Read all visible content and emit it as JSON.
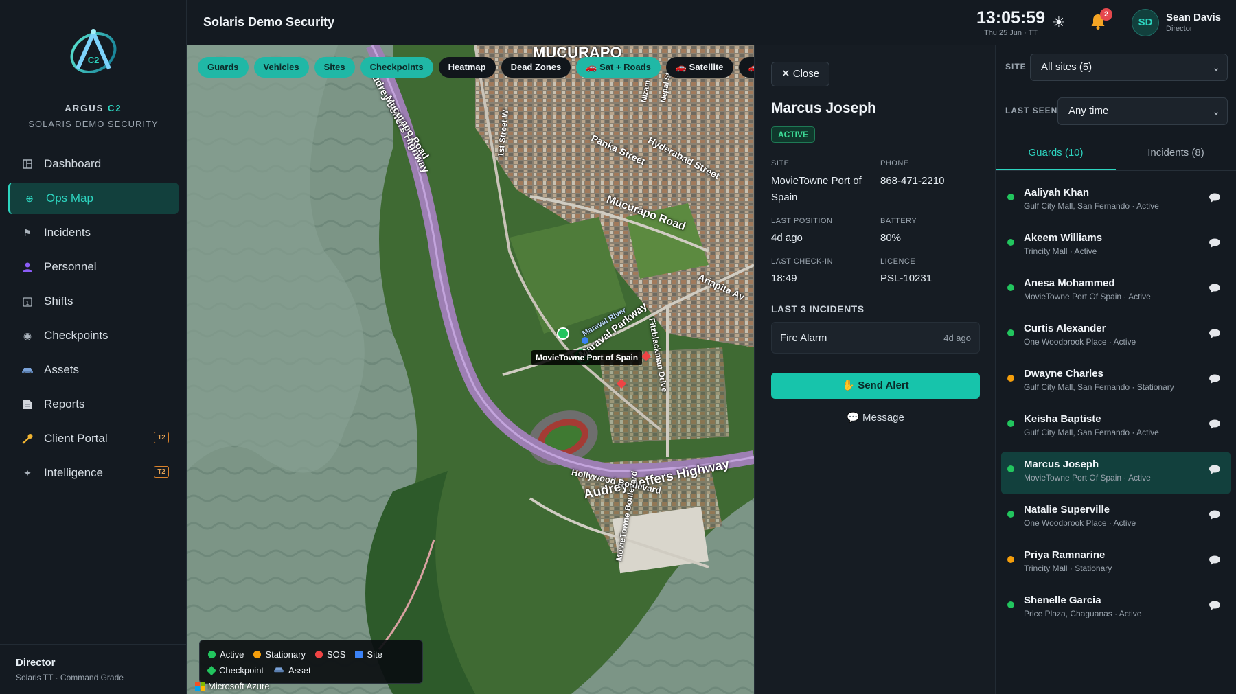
{
  "brand": {
    "name_main": "ARGUS",
    "name_accent": "C2",
    "subtitle": "SOLARIS DEMO SECURITY"
  },
  "sidebar": {
    "items": [
      {
        "label": "Dashboard",
        "icon": "dashboard-icon"
      },
      {
        "label": "Ops Map",
        "icon": "globe-icon",
        "active": true
      },
      {
        "label": "Incidents",
        "icon": "flag-icon"
      },
      {
        "label": "Personnel",
        "icon": "person-icon"
      },
      {
        "label": "Shifts",
        "icon": "calendar-icon"
      },
      {
        "label": "Checkpoints",
        "icon": "target-icon"
      },
      {
        "label": "Assets",
        "icon": "car-icon"
      },
      {
        "label": "Reports",
        "icon": "document-icon"
      },
      {
        "label": "Client Portal",
        "icon": "key-icon",
        "tier": "T2"
      },
      {
        "label": "Intelligence",
        "icon": "sparkle-icon",
        "tier": "T2"
      }
    ],
    "footer": {
      "role": "Director",
      "org": "Solaris TT · Command Grade"
    }
  },
  "topbar": {
    "title": "Solaris Demo Security",
    "time": "13:05:59",
    "date": "Thu 25 Jun · TT",
    "notification_count": "2",
    "user": {
      "initials": "SD",
      "name": "Sean Davis",
      "role": "Director"
    }
  },
  "map": {
    "chips": [
      {
        "label": "Guards",
        "on": true
      },
      {
        "label": "Vehicles",
        "on": true
      },
      {
        "label": "Sites",
        "on": true
      },
      {
        "label": "Checkpoints",
        "on": true
      },
      {
        "label": "Heatmap",
        "on": false
      },
      {
        "label": "Dead Zones",
        "on": false
      },
      {
        "label": "🚗 Sat + Roads",
        "on": true
      },
      {
        "label": "🚗 Satellite",
        "on": false
      },
      {
        "label": "🚗 Ro",
        "on": false
      }
    ],
    "labels": {
      "district": "MUCURAPO",
      "road_1": "Audrey Jeffers Highway",
      "road_2": "Audrey Jeffers Highway",
      "road_3": "Mucurapo Road",
      "road_4": "Mucurapo Road",
      "road_5": "Panka Street",
      "road_6": "Hyderabad Street",
      "road_7": "Maraval Parkway",
      "road_8": "Ariapita Av",
      "road_9": "Fitzblackman Drive",
      "road_10": "Hollywood Boulevard",
      "road_11": "MovieTowne Boulevard",
      "road_12": "1st Street W",
      "road_13": "Maraval River",
      "road_14": "Nizam St",
      "road_15": "Nepal St",
      "pin": "MovieTowne Port of Spain"
    },
    "legend": [
      {
        "label": "Active",
        "color": "#22c55e",
        "shape": "dot"
      },
      {
        "label": "Stationary",
        "color": "#f59e0b",
        "shape": "dot"
      },
      {
        "label": "SOS",
        "color": "#ef4444",
        "shape": "dot"
      },
      {
        "label": "Site",
        "color": "#3b82f6",
        "shape": "square"
      },
      {
        "label": "Checkpoint",
        "color": "#22c55e",
        "shape": "diamond"
      },
      {
        "label": "Asset",
        "color": "#9ca3af",
        "shape": "car"
      }
    ],
    "attribution": "Microsoft Azure"
  },
  "detail": {
    "close_label": "Close",
    "name": "Marcus Joseph",
    "status": "ACTIVE",
    "fields": {
      "site_label": "SITE",
      "site_value": "MovieTowne Port of Spain",
      "phone_label": "PHONE",
      "phone_value": "868-471-2210",
      "last_position_label": "LAST POSITION",
      "last_position_value": "4d ago",
      "battery_label": "BATTERY",
      "battery_value": "80%",
      "last_checkin_label": "LAST CHECK-IN",
      "last_checkin_value": "18:49",
      "licence_label": "LICENCE",
      "licence_value": "PSL-10231"
    },
    "incidents_title": "LAST 3 INCIDENTS",
    "incidents": [
      {
        "type": "Fire Alarm",
        "age": "4d ago"
      }
    ],
    "send_alert_label": "Send Alert",
    "message_label": "Message"
  },
  "list": {
    "site_filter_label": "SITE",
    "site_filter_value": "All sites (5)",
    "last_seen_label": "LAST SEEN",
    "last_seen_value": "Any time",
    "tabs": [
      {
        "label": "Guards (10)",
        "active": true
      },
      {
        "label": "Incidents (8)",
        "active": false
      }
    ],
    "guards": [
      {
        "name": "Aaliyah Khan",
        "sub": "Gulf City Mall, San Fernando · Active",
        "status": "active"
      },
      {
        "name": "Akeem Williams",
        "sub": "Trincity Mall · Active",
        "status": "active"
      },
      {
        "name": "Anesa Mohammed",
        "sub": "MovieTowne Port Of Spain · Active",
        "status": "active"
      },
      {
        "name": "Curtis Alexander",
        "sub": "One Woodbrook Place · Active",
        "status": "active"
      },
      {
        "name": "Dwayne Charles",
        "sub": "Gulf City Mall, San Fernando · Stationary",
        "status": "stationary"
      },
      {
        "name": "Keisha Baptiste",
        "sub": "Gulf City Mall, San Fernando · Active",
        "status": "active"
      },
      {
        "name": "Marcus Joseph",
        "sub": "MovieTowne Port Of Spain · Active",
        "status": "active",
        "selected": true
      },
      {
        "name": "Natalie Superville",
        "sub": "One Woodbrook Place · Active",
        "status": "active"
      },
      {
        "name": "Priya Ramnarine",
        "sub": "Trincity Mall · Stationary",
        "status": "stationary"
      },
      {
        "name": "Shenelle Garcia",
        "sub": "Price Plaza, Chaguanas · Active",
        "status": "active"
      }
    ]
  },
  "colors": {
    "accent": "#2dd4bf",
    "active": "#22c55e",
    "stationary": "#f59e0b",
    "sos": "#ef4444",
    "site": "#3b82f6"
  }
}
